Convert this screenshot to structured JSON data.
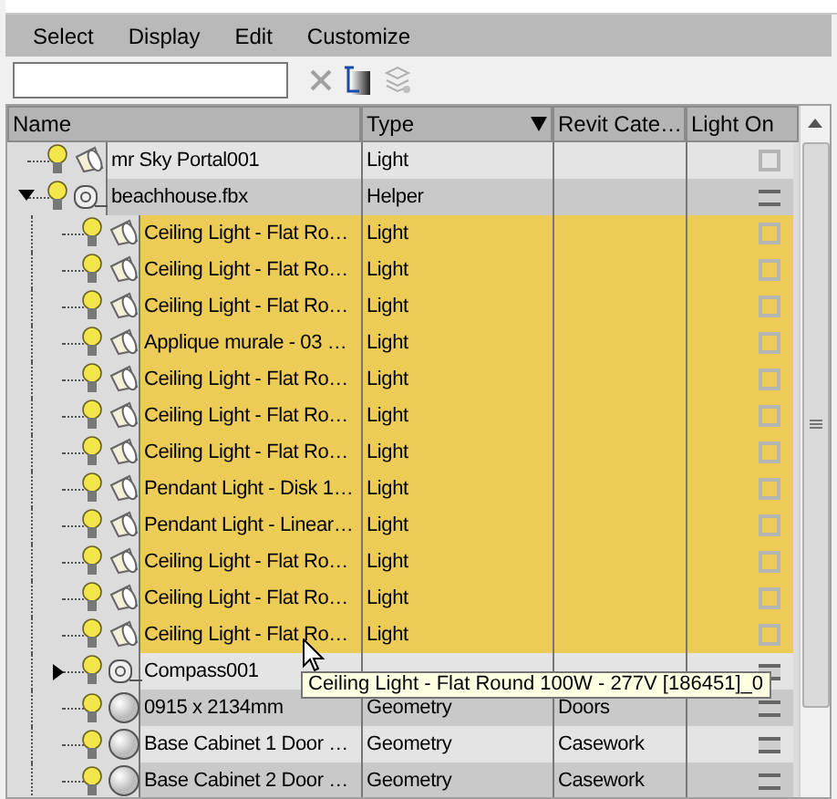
{
  "menu": [
    "Select",
    "Display",
    "Edit",
    "Customize"
  ],
  "columns": [
    {
      "label": "Name",
      "sorted": false
    },
    {
      "label": "Type",
      "sorted": true
    },
    {
      "label": "Revit Cate…",
      "sorted": false
    },
    {
      "label": "Light On",
      "sorted": false
    }
  ],
  "tree": [
    {
      "name": "mr Sky Portal001",
      "kind": "light",
      "type": "Light",
      "light_on": false,
      "mixed": false,
      "selected": false
    },
    {
      "name": "beachhouse.fbx",
      "kind": "helper",
      "type": "Helper",
      "light_on": false,
      "mixed": true,
      "selected": false,
      "expanded": true,
      "children": [
        {
          "name": "Ceiling Light - Flat Ro…",
          "kind": "light",
          "type": "Light",
          "light_on": false,
          "mixed": false,
          "selected": true
        },
        {
          "name": "Ceiling Light - Flat Ro…",
          "kind": "light",
          "type": "Light",
          "light_on": false,
          "mixed": false,
          "selected": true
        },
        {
          "name": "Ceiling Light - Flat Ro…",
          "kind": "light",
          "type": "Light",
          "light_on": false,
          "mixed": false,
          "selected": true
        },
        {
          "name": "Applique murale - 03 …",
          "kind": "light",
          "type": "Light",
          "light_on": false,
          "mixed": false,
          "selected": true
        },
        {
          "name": "Ceiling Light - Flat Ro…",
          "kind": "light",
          "type": "Light",
          "light_on": false,
          "mixed": false,
          "selected": true
        },
        {
          "name": "Ceiling Light - Flat Ro…",
          "kind": "light",
          "type": "Light",
          "light_on": false,
          "mixed": false,
          "selected": true
        },
        {
          "name": "Ceiling Light - Flat Ro…",
          "kind": "light",
          "type": "Light",
          "light_on": false,
          "mixed": false,
          "selected": true
        },
        {
          "name": "Pendant Light - Disk 1…",
          "kind": "light",
          "type": "Light",
          "light_on": false,
          "mixed": false,
          "selected": true
        },
        {
          "name": "Pendant Light - Linear…",
          "kind": "light",
          "type": "Light",
          "light_on": false,
          "mixed": false,
          "selected": true
        },
        {
          "name": "Ceiling Light - Flat Ro…",
          "kind": "light",
          "type": "Light",
          "light_on": false,
          "mixed": false,
          "selected": true
        },
        {
          "name": "Ceiling Light - Flat Ro…",
          "kind": "light",
          "type": "Light",
          "light_on": false,
          "mixed": false,
          "selected": true
        },
        {
          "name": "Ceiling Light - Flat Ro…",
          "kind": "light",
          "type": "Light",
          "light_on": false,
          "mixed": false,
          "selected": true
        },
        {
          "name": "Compass001",
          "kind": "helper",
          "light_on": false,
          "mixed": true,
          "selected": false,
          "expanded": false
        },
        {
          "name": "0915 x 2134mm",
          "kind": "geometry",
          "type": "Geometry",
          "revit_category": "Doors",
          "light_on": false,
          "mixed": true,
          "selected": false
        },
        {
          "name": "Base Cabinet 1 Door …",
          "kind": "geometry",
          "type": "Geometry",
          "revit_category": "Casework",
          "light_on": false,
          "mixed": true,
          "selected": false
        },
        {
          "name": "Base Cabinet 2 Door …",
          "kind": "geometry",
          "type": "Geometry",
          "revit_category": "Casework",
          "light_on": false,
          "mixed": true,
          "selected": false
        }
      ]
    }
  ],
  "tooltip": "Ceiling Light - Flat Round 100W - 277V [186451]_0"
}
